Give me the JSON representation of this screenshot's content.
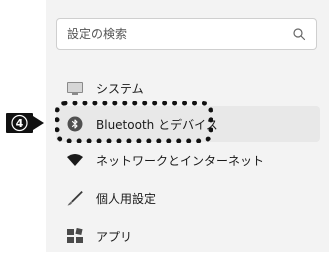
{
  "search": {
    "placeholder": "設定の検索",
    "icon": "search-icon"
  },
  "annotation": {
    "step_number": "4",
    "target": "Bluetooth とデバイス"
  },
  "nav": {
    "selected_index": 1,
    "items": [
      {
        "label": "システム",
        "icon": "monitor-icon"
      },
      {
        "label": "Bluetooth とデバイス",
        "icon": "bluetooth-icon"
      },
      {
        "label": "ネットワークとインターネット",
        "icon": "wifi-icon"
      },
      {
        "label": "個人用設定",
        "icon": "brush-icon"
      },
      {
        "label": "アプリ",
        "icon": "apps-icon"
      }
    ]
  },
  "colors": {
    "panel_background": "#f3f3f3",
    "selected_background": "#e8e8e8",
    "annotation": "#111111"
  }
}
